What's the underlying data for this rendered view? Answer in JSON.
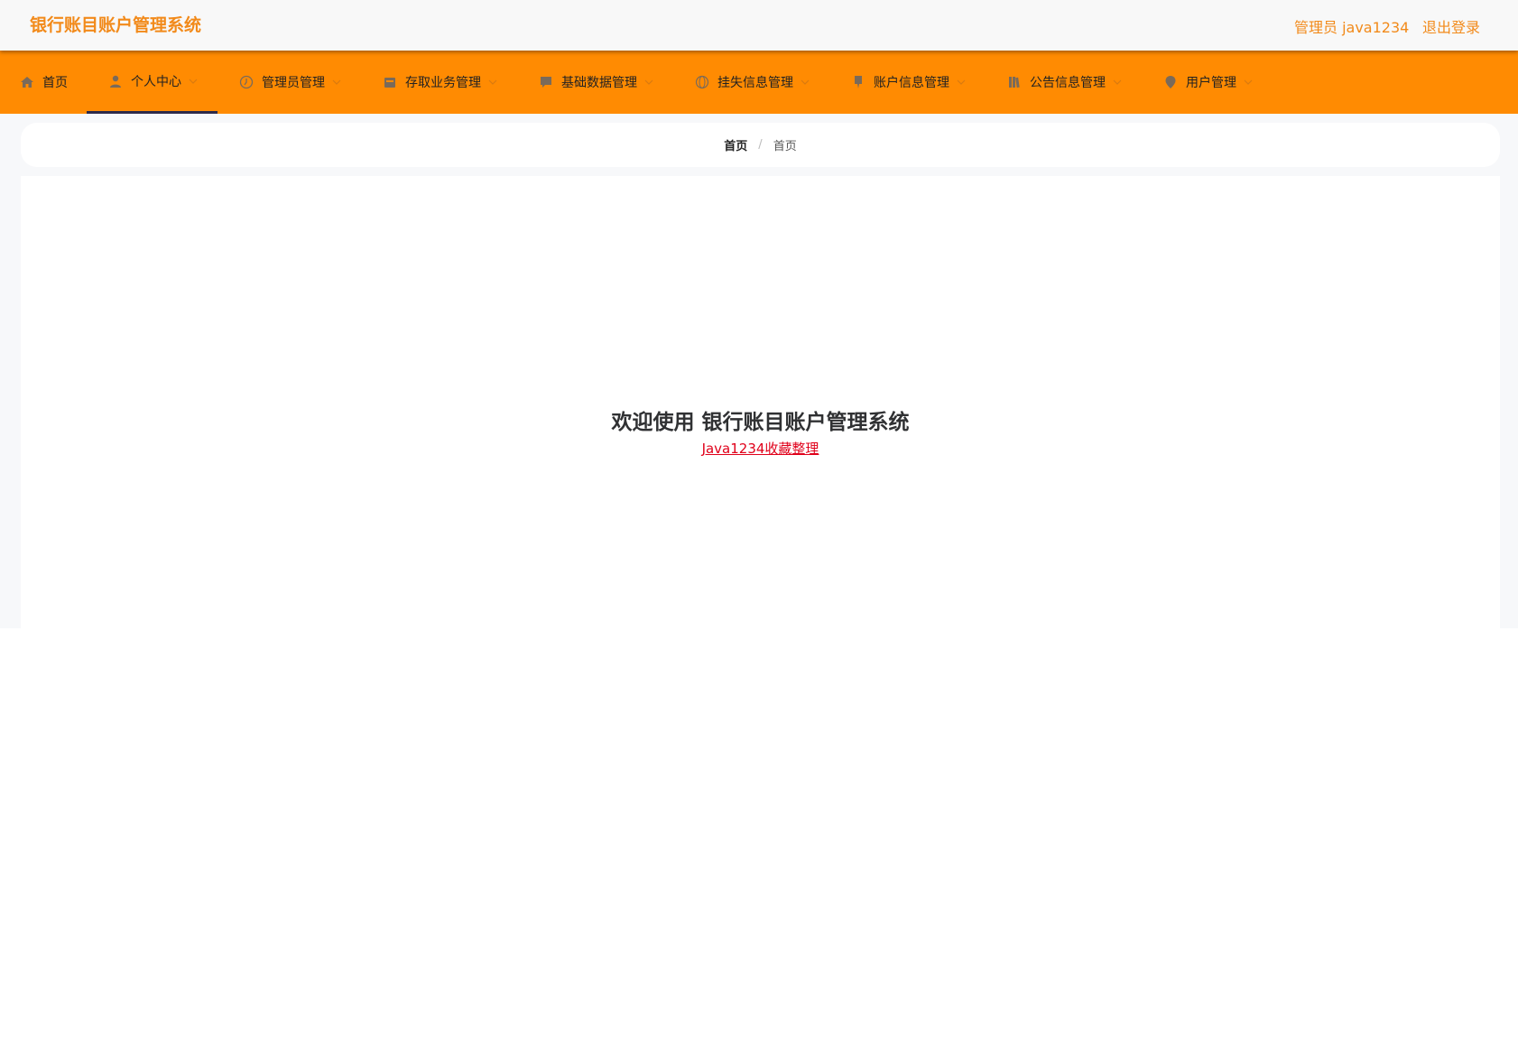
{
  "header": {
    "app_title": "银行账目账户管理系统",
    "user_info": "管理员 java1234",
    "logout": "退出登录",
    "accent_color": "#f28a1a"
  },
  "nav": {
    "bar_color": "#ff8b02",
    "items": [
      {
        "label": "首页",
        "icon": "home-icon",
        "dropdown": false
      },
      {
        "label": "个人中心",
        "icon": "user-icon",
        "dropdown": true,
        "active": true
      },
      {
        "label": "管理员管理",
        "icon": "clock-icon",
        "dropdown": true
      },
      {
        "label": "存取业务管理",
        "icon": "calendar-icon",
        "dropdown": true
      },
      {
        "label": "基础数据管理",
        "icon": "chat-icon",
        "dropdown": true
      },
      {
        "label": "挂失信息管理",
        "icon": "globe-icon",
        "dropdown": true
      },
      {
        "label": "账户信息管理",
        "icon": "pin-icon",
        "dropdown": true
      },
      {
        "label": "公告信息管理",
        "icon": "books-icon",
        "dropdown": true
      },
      {
        "label": "用户管理",
        "icon": "location-icon",
        "dropdown": true
      }
    ]
  },
  "breadcrumb": {
    "root": "首页",
    "separator": "/",
    "current": "首页"
  },
  "main": {
    "welcome": "欢迎使用 银行账目账户管理系统",
    "link_text": "Java1234收藏整理",
    "link_color": "#e0001a"
  }
}
